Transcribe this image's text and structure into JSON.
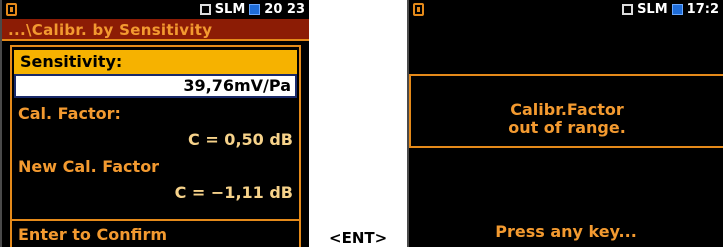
{
  "left_screen": {
    "status": {
      "indicator": "SLM",
      "time": "20 23"
    },
    "path_title": "...\\Calibr. by Sensitivity",
    "sensitivity_label": "Sensitivity:",
    "sensitivity_value": "39,76mV/Pa",
    "cal_factor_label": "Cal. Factor:",
    "cal_factor_value": "C = 0,50 dB",
    "new_cal_label": "New Cal. Factor",
    "new_cal_value": "C = −1,11 dB",
    "confirm_text": "Enter to Confirm"
  },
  "key_label": "<ENT>",
  "right_screen": {
    "status": {
      "indicator": "SLM",
      "time": "17:2"
    },
    "message_line1": "Calibr.Factor",
    "message_line2": "out of range.",
    "press_text": "Press any key..."
  },
  "colors": {
    "accent_orange": "#e58a1a",
    "text_orange": "#f39a30",
    "title_bar_red": "#8c1c05",
    "highlight_yellow": "#f6b200",
    "status_blue": "#1e6cd8",
    "screen_bg": "#000000"
  },
  "icons": [
    "battery-icon",
    "slm-mode-icon",
    "status-square-icon"
  ]
}
